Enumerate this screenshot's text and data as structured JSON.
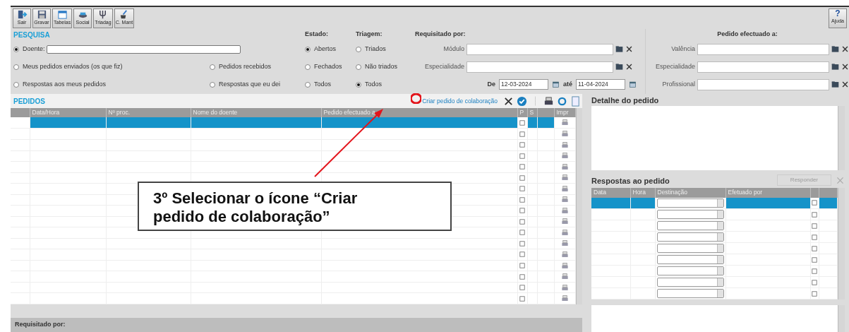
{
  "toolbar": {
    "buttons": [
      {
        "label": "Sair",
        "kind": "exit"
      },
      {
        "label": "Gravar",
        "kind": "save"
      },
      {
        "label": "Tabelas",
        "kind": "calendar"
      },
      {
        "label": "Social",
        "kind": "bowl"
      },
      {
        "label": "Triadag",
        "kind": "fork"
      },
      {
        "label": "C. Mant",
        "kind": "brush"
      }
    ],
    "help": {
      "symbol": "?",
      "label": "Ajuda"
    }
  },
  "pesquisa": {
    "title": "PESQUISA",
    "options": [
      {
        "label": "Doente:",
        "selected": true
      },
      {
        "label": "Meus pedidos enviados (os que fiz)",
        "selected": false
      },
      {
        "label": "Pedidos recebidos",
        "selected": false
      },
      {
        "label": "Respostas aos meus pedidos",
        "selected": false
      },
      {
        "label": "Respostas que eu dei",
        "selected": false
      }
    ]
  },
  "estado": {
    "title": "Estado:",
    "options": [
      {
        "label": "Abertos",
        "selected": true
      },
      {
        "label": "Fechados",
        "selected": false
      },
      {
        "label": "Todos",
        "selected": false
      }
    ]
  },
  "triagem": {
    "title": "Triagem:",
    "options": [
      {
        "label": "Triados",
        "selected": false
      },
      {
        "label": "Não triados",
        "selected": false
      },
      {
        "label": "Todos",
        "selected": true
      }
    ]
  },
  "requisitado_por": {
    "title": "Requisitado por:",
    "fields": [
      {
        "label": "Módulo"
      },
      {
        "label": "Especialidade"
      }
    ],
    "date_from_label": "De",
    "date_from": "12-03-2024",
    "date_to_label": "até",
    "date_to": "11-04-2024"
  },
  "pedido_efectuado_a": {
    "title": "Pedido efectuado a:",
    "fields": [
      {
        "label": "Valência"
      },
      {
        "label": "Especialidade"
      },
      {
        "label": "Profissional"
      }
    ]
  },
  "pedidos": {
    "title": "PEDIDOS",
    "create_button": "Criar pedido de colaboração",
    "columns": [
      "Data/Hora",
      "Nº proc.",
      "Nome do doente",
      "Pedido efectuado a",
      "P",
      "S",
      "Impr"
    ],
    "rows": [
      {
        "selected": true
      },
      {
        "selected": false
      },
      {
        "selected": false
      },
      {
        "selected": false
      },
      {
        "selected": false
      },
      {
        "selected": false
      },
      {
        "selected": false
      },
      {
        "selected": false
      },
      {
        "selected": false
      },
      {
        "selected": false
      },
      {
        "selected": false
      },
      {
        "selected": false
      },
      {
        "selected": false
      },
      {
        "selected": false
      },
      {
        "selected": false
      },
      {
        "selected": false
      },
      {
        "selected": false
      }
    ]
  },
  "detalhe": {
    "title": "Detalhe do pedido"
  },
  "respostas": {
    "title": "Respostas ao pedido",
    "button": {
      "label": "Responder",
      "disabled": true
    },
    "columns": [
      "Data",
      "Hora",
      "Destinação",
      "Efetuado por"
    ],
    "rows": [
      {
        "selected": true
      },
      {
        "selected": false
      },
      {
        "selected": false
      },
      {
        "selected": false
      },
      {
        "selected": false
      },
      {
        "selected": false
      },
      {
        "selected": false
      },
      {
        "selected": false
      },
      {
        "selected": false
      }
    ]
  },
  "footer": {
    "label": "Requisitado por:"
  },
  "annotation": {
    "text": "3º Selecionar o ícone “Criar pedido de colaboração”"
  }
}
